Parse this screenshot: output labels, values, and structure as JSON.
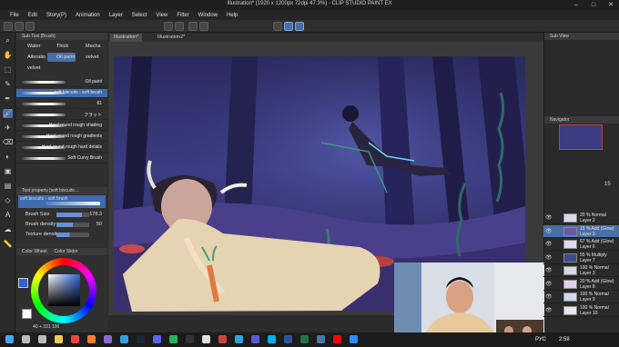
{
  "window": {
    "title": "Illustration* (1920 x 1200px 72dpi 47.3%)  - CLIP STUDIO PAINT EX",
    "controls": {
      "minimize": "–",
      "maximize": "□",
      "close": "✕"
    }
  },
  "menu": [
    "File",
    "Edit",
    "Story(P)",
    "Animation",
    "Layer",
    "Select",
    "View",
    "Filter",
    "Window",
    "Help"
  ],
  "tool_icons": [
    "magnifier-icon",
    "move-hand-icon",
    "selection-icon",
    "eyedropper-icon",
    "pen-icon",
    "brush-icon",
    "airbrush-icon",
    "eraser-icon",
    "blend-icon",
    "fill-icon",
    "gradient-icon",
    "figure-icon",
    "text-icon",
    "balloon-icon",
    "ruler-icon"
  ],
  "sub_tool": {
    "header": "Sub Tool [Brush]",
    "groups": [
      "Water",
      "Thick",
      "Mecha",
      "Alteratio",
      "Oil paint",
      "velvet",
      "velvet"
    ],
    "selected_group": "Oil paint",
    "brushes": [
      {
        "name": "Oil paint",
        "selected": false
      },
      {
        "name": "soft biscuits - soft brush",
        "selected": true
      },
      {
        "name": "61",
        "selected": false
      },
      {
        "name": "フラット",
        "selected": false
      },
      {
        "name": "Hard round rough shading",
        "selected": false
      },
      {
        "name": "Hard round rough gradients",
        "selected": false
      },
      {
        "name": "Hard round rough hard details",
        "selected": false
      },
      {
        "name": "Soft Curvy Brush",
        "selected": false
      }
    ]
  },
  "tool_property": {
    "header": "Tool property [soft biscuits...",
    "brush_label": "soft biscuits - soft brush",
    "rows": [
      {
        "label": "Brush Size",
        "value": "178.3",
        "fill": 0.78
      },
      {
        "label": "Brush density",
        "value": "50",
        "fill": 0.5
      },
      {
        "label": "Texture density",
        "value": "",
        "fill": 0.4
      }
    ]
  },
  "color": {
    "header": "Color Wheel",
    "header2": "Color Slider",
    "readout": "40  +  331  196",
    "main_color": "#2f62d8",
    "sub_color": "#ffffff"
  },
  "documents": [
    {
      "label": "Illustration*",
      "selected": true
    },
    {
      "label": "Illustration2*",
      "selected": false
    }
  ],
  "navigator": {
    "header": "Navigator",
    "subview_header": "Sub View"
  },
  "layers": [
    {
      "mode": "20 % Normal",
      "name": "Layer 2",
      "selected": false,
      "thumb": "#d8d8e8"
    },
    {
      "mode": "15 % Add (Glow)",
      "name": "Layer 3",
      "selected": true,
      "thumb": "#6a5aa8"
    },
    {
      "mode": "67 % Add (Glow)",
      "name": "Layer 6",
      "selected": false,
      "thumb": "#e6d8f0"
    },
    {
      "mode": "55 % Multiply",
      "name": "Layer 7",
      "selected": false,
      "thumb": "#3a4a8a"
    },
    {
      "mode": "100 % Normal",
      "name": "Layer 3",
      "selected": false,
      "thumb": "#d8d8e8"
    },
    {
      "mode": "20 % Add (Glow)",
      "name": "Layer 8",
      "selected": false,
      "thumb": "#e0d0f0"
    },
    {
      "mode": "100 % Normal",
      "name": "Layer 9",
      "selected": false,
      "thumb": "#d0d8f0"
    },
    {
      "mode": "100 % Normal",
      "name": "Layer 10",
      "selected": false,
      "thumb": "#e8e8f0"
    }
  ],
  "layer_opacity": "15",
  "taskbar": {
    "lang": "РУС",
    "time": "2:58",
    "icons": [
      "windows-start-icon",
      "search-icon",
      "taskview-icon",
      "explorer-icon",
      "chrome-icon",
      "firefox-icon",
      "app-icon",
      "telegram-icon",
      "steam-icon",
      "discord-icon",
      "spotify-icon",
      "obs-icon",
      "csp-icon",
      "paint-icon",
      "photoshop-icon",
      "teams-icon",
      "skype-icon",
      "word-icon",
      "excel-icon",
      "vk-icon",
      "youtube-icon",
      "zoom-icon"
    ]
  }
}
